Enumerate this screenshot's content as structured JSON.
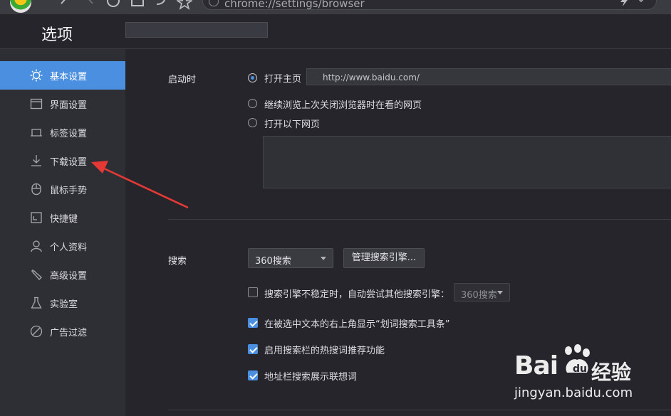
{
  "browser": {
    "url": "chrome://settings/browser",
    "icons": [
      "browser-logo-icon",
      "back-icon",
      "forward-icon",
      "refresh-icon",
      "home-icon",
      "undo-icon",
      "star-icon",
      "lightning-icon",
      "chevron-down-icon"
    ]
  },
  "header": {
    "title": "选项",
    "search_placeholder": ""
  },
  "sidebar": {
    "items": [
      {
        "label": "基本设置",
        "icon": "gear-icon",
        "active": true
      },
      {
        "label": "界面设置",
        "icon": "window-icon",
        "active": false
      },
      {
        "label": "标签设置",
        "icon": "tab-icon",
        "active": false
      },
      {
        "label": "下载设置",
        "icon": "download-icon",
        "active": false
      },
      {
        "label": "鼠标手势",
        "icon": "mouse-icon",
        "active": false
      },
      {
        "label": "快捷键",
        "icon": "keyboard-icon",
        "active": false
      },
      {
        "label": "个人资料",
        "icon": "user-icon",
        "active": false
      },
      {
        "label": "高级设置",
        "icon": "wrench-icon",
        "active": false
      },
      {
        "label": "实验室",
        "icon": "flask-icon",
        "active": false
      },
      {
        "label": "广告过滤",
        "icon": "block-icon",
        "active": false
      }
    ]
  },
  "startup": {
    "label": "启动时",
    "options": [
      {
        "label": "打开主页",
        "checked": true
      },
      {
        "label": "继续浏览上次关闭浏览器时在看的网页",
        "checked": false
      },
      {
        "label": "打开以下网页",
        "checked": false
      }
    ],
    "homepage_url": "http://www.baidu.com/"
  },
  "search": {
    "label": "搜索",
    "engine": "360搜索",
    "manage_button": "管理搜索引擎...",
    "fallback_label": "搜索引擎不稳定时，自动尝试其他搜索引擎：",
    "fallback_engine": "360搜索",
    "checkboxes": [
      {
        "label": "在被选中文本的右上角显示“划词搜索工具条”",
        "checked": true
      },
      {
        "label": "启用搜索栏的热搜词推荐功能",
        "checked": true
      },
      {
        "label": "地址栏搜索展示联想词",
        "checked": true
      }
    ],
    "fallback_checked": false
  },
  "watermark": {
    "brand": "Bai",
    "brand_cn": "经验",
    "url": "jingyan.baidu.com"
  },
  "colors": {
    "accent": "#4b8fe0",
    "annotation_arrow": "#e53935"
  }
}
